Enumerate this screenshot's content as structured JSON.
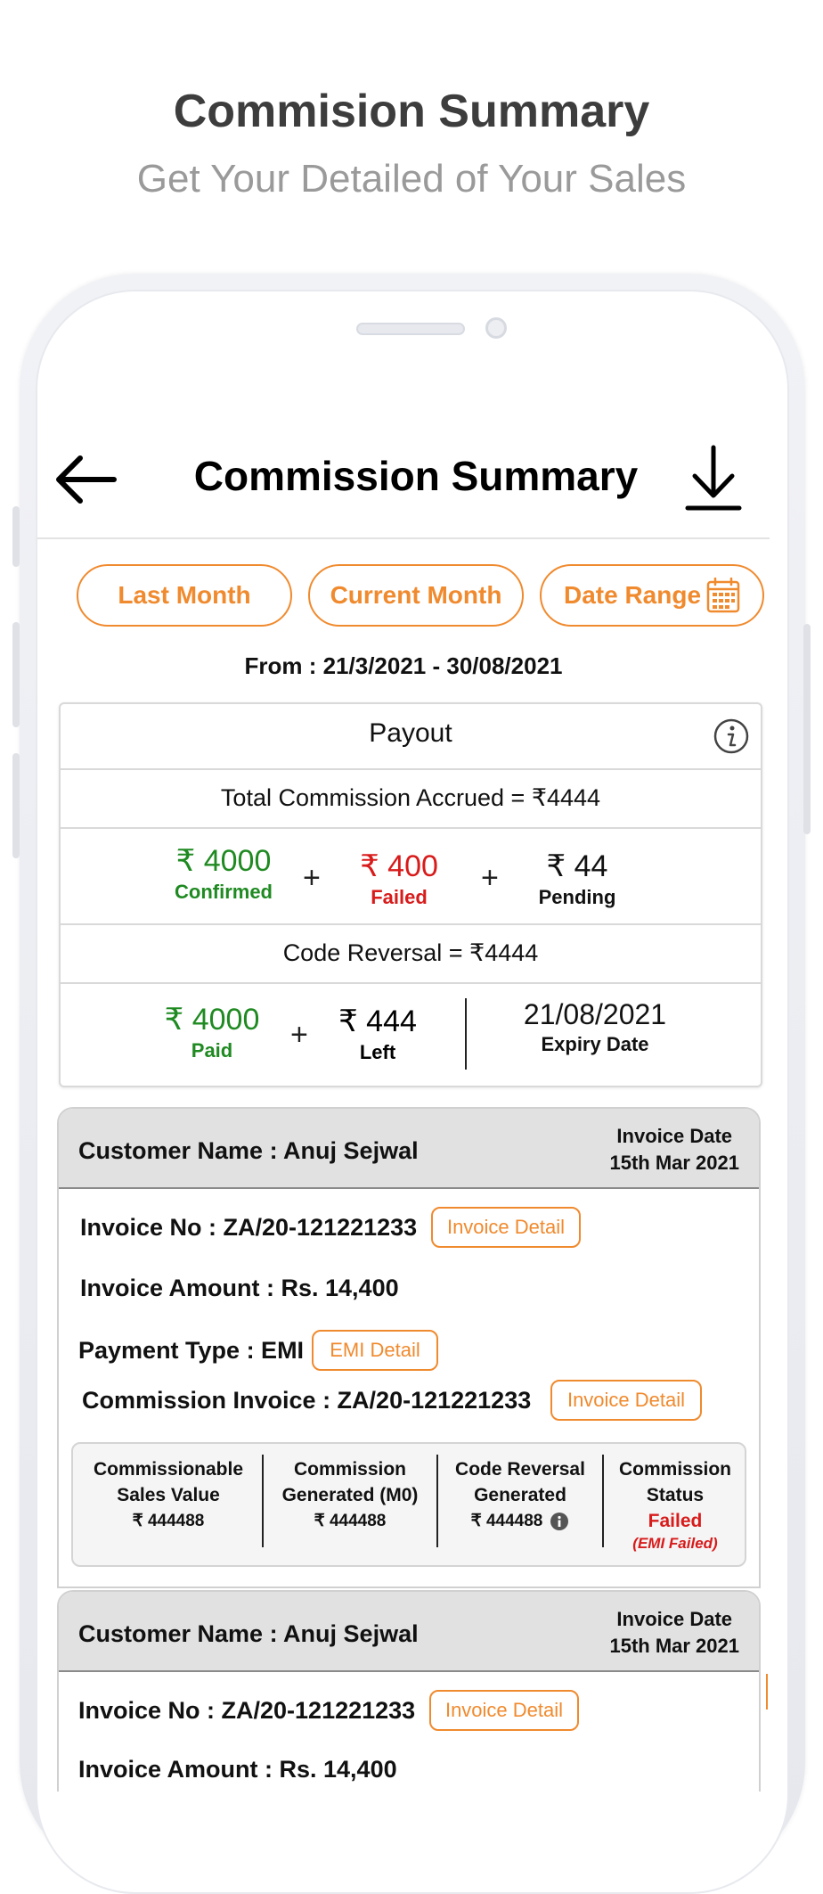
{
  "promo": {
    "title": "Commision Summary",
    "subtitle": "Get Your Detailed of Your Sales"
  },
  "appbar": {
    "title": "Commission Summary",
    "back_icon": "arrow-left-icon",
    "download_icon": "download-icon"
  },
  "filters": {
    "last_month": "Last Month",
    "current_month": "Current Month",
    "date_range": "Date Range",
    "accent": "#f08a2e"
  },
  "range_text": "From : 21/3/2021 - 30/08/2021",
  "payout": {
    "title": "Payout",
    "total_label": "Total Commission Accrued =  ₹4444",
    "confirmed_amount": "₹ 4000",
    "confirmed_label": "Confirmed",
    "failed_amount": "₹ 400",
    "failed_label": "Failed",
    "pending_amount": "₹ 44",
    "pending_label": "Pending",
    "plus": "+",
    "code_reversal": "Code Reversal =  ₹4444",
    "paid_amount": "₹ 4000",
    "paid_label": "Paid",
    "left_amount": "₹ 444",
    "left_label": "Left",
    "expiry_date": "21/08/2021",
    "expiry_label": "Expiry Date"
  },
  "invoices": [
    {
      "customer": "Customer Name : Anuj Sejwal",
      "invoice_date_label": "Invoice Date",
      "invoice_date": "15th Mar 2021",
      "invoice_no": "Invoice No : ZA/20-121221233",
      "invoice_detail_btn": "Invoice Detail",
      "invoice_amount": "Invoice Amount : Rs. 14,400",
      "payment_type": "Payment Type : EMI",
      "emi_detail_btn": "EMI Detail",
      "commission_invoice": "Commission Invoice : ZA/20-121221233",
      "commission_invoice_btn": "Invoice Detail",
      "stats": {
        "c1_l1": "Commissionable",
        "c1_l2": "Sales Value",
        "c1_v": "₹ 444488",
        "c2_l1": "Commission",
        "c2_l2": "Generated (M0)",
        "c2_v": "₹ 444488",
        "c3_l1": "Code Reversal",
        "c3_l2": "Generated",
        "c3_v": "₹ 444488",
        "c4_l1": "Commission",
        "c4_l2": "Status",
        "c4_v": "Failed",
        "c4_note": "(EMI Failed)"
      }
    },
    {
      "customer": "Customer Name : Anuj Sejwal",
      "invoice_date_label": "Invoice Date",
      "invoice_date": "15th Mar 2021",
      "invoice_no": "Invoice No : ZA/20-121221233",
      "invoice_detail_btn": "Invoice Detail",
      "invoice_amount": "Invoice Amount : Rs. 14,400"
    }
  ]
}
